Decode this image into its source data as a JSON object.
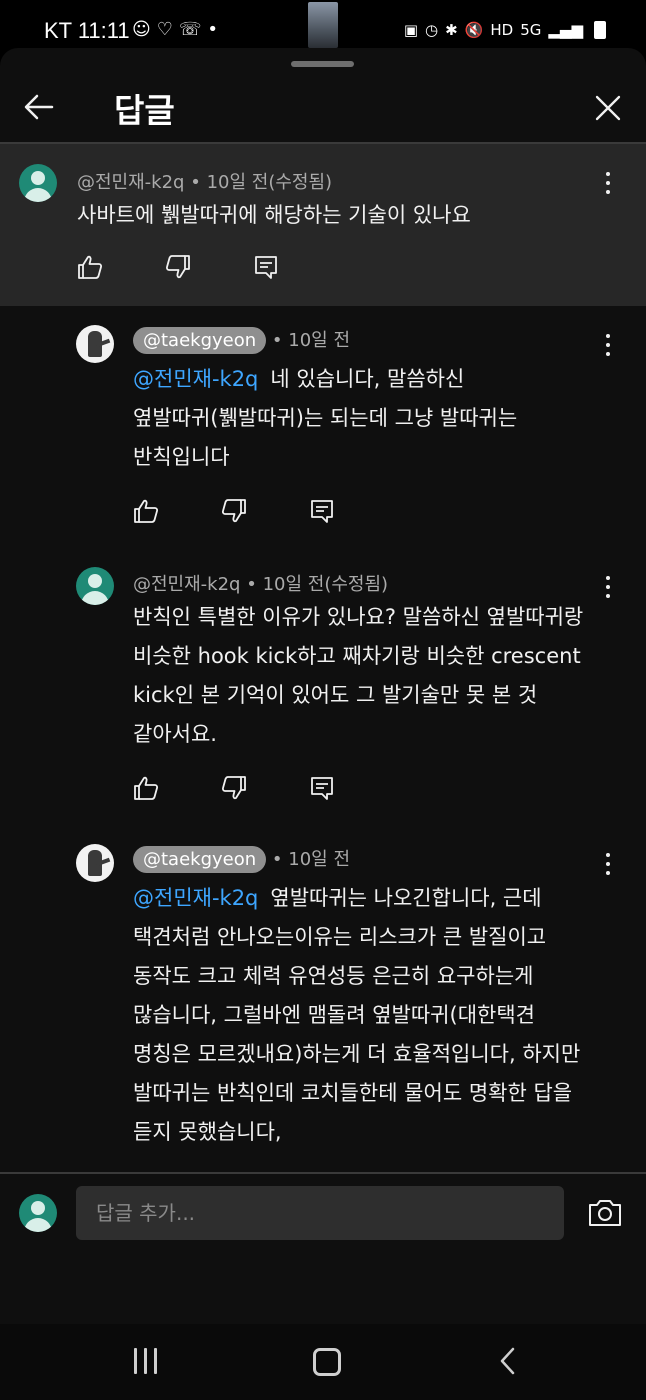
{
  "status_bar": {
    "carrier_time": "KT 11:11",
    "left_icons": [
      "☺",
      "♡",
      "☏",
      "•"
    ],
    "right_icons": [
      "▣",
      "◷",
      "✱",
      "🔇",
      "HD",
      "5G",
      "▂▄▆"
    ]
  },
  "header": {
    "title": "답글",
    "back_icon": "arrow-left-icon",
    "close_icon": "close-icon"
  },
  "parent_comment": {
    "author": "@전민재-k2q",
    "time": "10일 전(수정됨)",
    "text": "사바트에 뷁발따귀에 해당하는 기술이 있나요"
  },
  "replies": [
    {
      "author": "@taekgyeon",
      "author_is_creator": true,
      "time": "10일 전",
      "mention": "@전민재-k2q",
      "text": "네 있습니다, 말씀하신\n옆발따귀(뷁발따귀)는 되는데 그냥 발따귀는\n반칙입니다"
    },
    {
      "author": "@전민재-k2q",
      "author_is_creator": false,
      "time": "10일 전(수정됨)",
      "mention": "",
      "text": "반칙인 특별한 이유가 있나요? 말씀하신 옆발따귀랑\n비슷한 hook kick하고 째차기랑 비슷한 crescent\nkick인 본 기억이 있어도 그 발기술만 못 본 것\n같아서요."
    },
    {
      "author": "@taekgyeon",
      "author_is_creator": true,
      "time": "10일 전",
      "mention": "@전민재-k2q",
      "text": "옆발따귀는 나오긴합니다, 근데\n택견처럼 안나오는이유는 리스크가 큰 발질이고\n동작도 크고 체력 유연성등 은근히 요구하는게\n많습니다, 그럴바엔 맴돌려 옆발따귀(대한택견\n명칭은 모르겠내요)하는게 더 효율적입니다, 하지만\n발따귀는 반칙인데 코치들한테 물어도 명확한 답을\n듣지 못했습니다,"
    }
  ],
  "separator": "•",
  "composer": {
    "placeholder": "답글 추가..."
  },
  "colors": {
    "background": "#0f0f0f",
    "parent_bg": "#272727",
    "mention": "#3ea6ff",
    "chip": "#8f8f8f",
    "avatar_green": "#1f8a76"
  }
}
